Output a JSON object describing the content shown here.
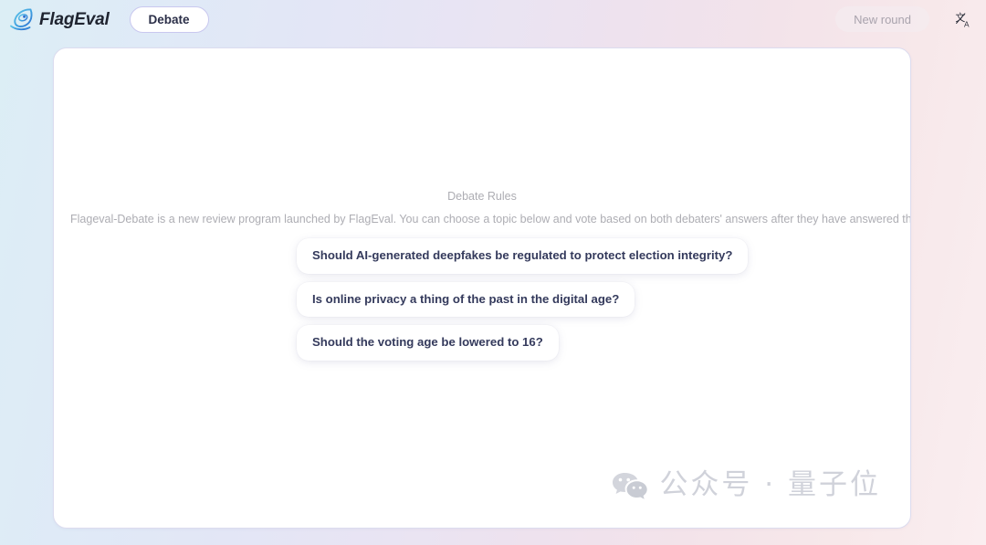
{
  "brand": {
    "name": "FlagEval",
    "logo_icon": "flag-sail-logo-icon"
  },
  "topbar": {
    "tab_debate_label": "Debate",
    "new_round_label": "New round",
    "language_icon": "translate-icon"
  },
  "main": {
    "rules_title": "Debate Rules",
    "rules_description": "Flageval-Debate is a new review program launched by FlagEval. You can choose a topic below and vote based on both debaters' answers after they have answered the question!",
    "topics": [
      {
        "label": "Should AI-generated deepfakes be regulated to protect election integrity?"
      },
      {
        "label": "Is online privacy a thing of the past in the digital age?"
      },
      {
        "label": "Should the voting age be lowered to 16?"
      }
    ]
  },
  "watermark": {
    "icon": "wechat-icon",
    "text": "公众号 · 量子位"
  },
  "colors": {
    "accent_border": "#c9c8ef",
    "topic_text": "#343a5c",
    "muted_text": "#adadb3",
    "panel_bg": "#ffffff",
    "watermark_text": "#d0d2da"
  }
}
